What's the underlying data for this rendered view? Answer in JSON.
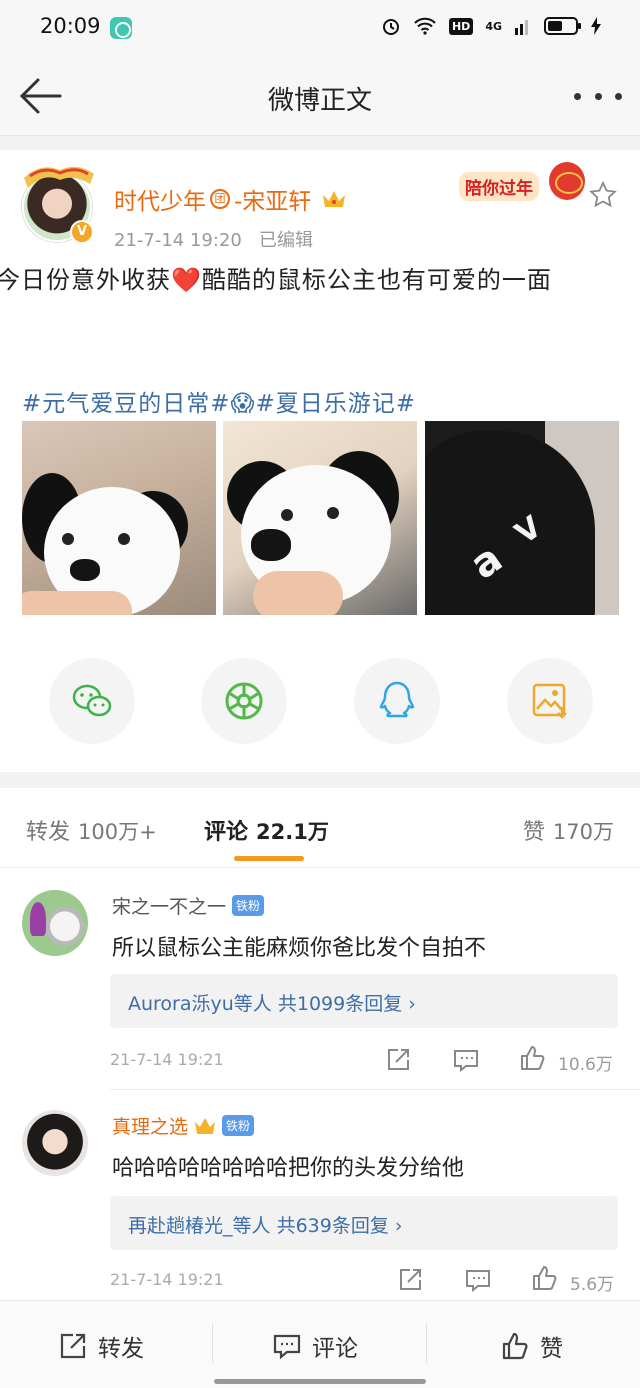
{
  "status_bar": {
    "time": "20:09",
    "hd": "HD",
    "network": "4G"
  },
  "nav": {
    "title": "微博正文",
    "back_icon": "arrow-left-icon",
    "more_icon": "more-dots-icon"
  },
  "post": {
    "username": "时代少年",
    "username_badge": "团",
    "username_suffix": "-宋亚轩",
    "time": "21-7-14 19:20",
    "edited": "已编辑",
    "promo": "陪你过年",
    "text": "今日份意外收获❤️酷酷的鼠标公主也有可爱的一面",
    "hashtags": "#元气爱豆的日常#😱#夏日乐游记#"
  },
  "share": [
    {
      "name": "wechat",
      "color": "#3cb24b"
    },
    {
      "name": "moments",
      "color": "#52b848"
    },
    {
      "name": "qq",
      "color": "#2fa4e7"
    },
    {
      "name": "save-image",
      "color": "#f0a82a"
    }
  ],
  "tabs": {
    "repost_label": "转发",
    "repost_count": "100万+",
    "comments_label": "评论",
    "comments_count": "22.1万",
    "likes_label": "赞",
    "likes_count": "170万"
  },
  "comments": [
    {
      "name": "宋之一不之一",
      "badge": "铁粉",
      "text": "所以鼠标公主能麻烦你爸比发个自拍不",
      "reply_names": "Aurora泺yu等人",
      "reply_count": "共1099条回复 ›",
      "date": "21-7-14 19:21",
      "likes": "10.6万"
    },
    {
      "name": "真理之选",
      "badge": "铁粉",
      "text": "哈哈哈哈哈哈哈哈把你的头发分给他",
      "reply_names": "再赴趟椿光_等人",
      "reply_count": "共639条回复 ›",
      "date": "21-7-14 19:21",
      "likes": "5.6万"
    }
  ],
  "bottom_bar": {
    "repost": "转发",
    "comment": "评论",
    "like": "赞"
  },
  "colors": {
    "accent": "#f39a1e",
    "link": "#3d6ea8",
    "username": "#e86a0f"
  }
}
